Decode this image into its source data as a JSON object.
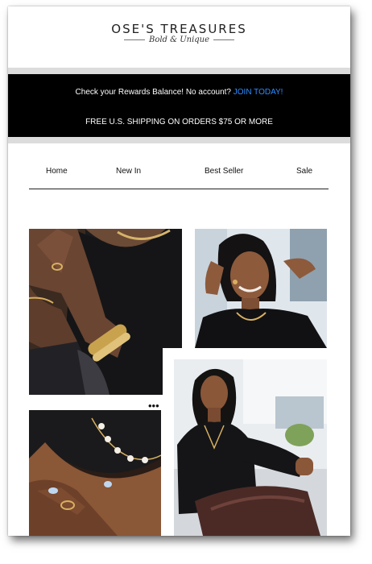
{
  "brand": {
    "name": "OSE'S TREASURES",
    "tagline": "Bold & Unique"
  },
  "banner": {
    "rewards_text": "Check your Rewards Balance! No account?",
    "join_link": "JOIN TODAY!",
    "shipping_text": "FREE U.S. SHIPPING ON ORDERS $75 OR MORE"
  },
  "nav": {
    "items": [
      {
        "label": "Home"
      },
      {
        "label": "New In"
      },
      {
        "label": "Best Seller"
      },
      {
        "label": "Sale"
      }
    ]
  },
  "gallery": {
    "more_icon": "ellipsis-icon",
    "photos": [
      {
        "subject": "gold-bangles-arms-photo"
      },
      {
        "subject": "smiling-woman-gold-earrings-photo"
      },
      {
        "subject": "pearl-necklace-ring-photo"
      },
      {
        "subject": "woman-seated-outdoors-photo"
      }
    ]
  },
  "colors": {
    "banner_bg": "#000000",
    "join_link": "#2e8cff",
    "separator": "#dcdcdc"
  }
}
